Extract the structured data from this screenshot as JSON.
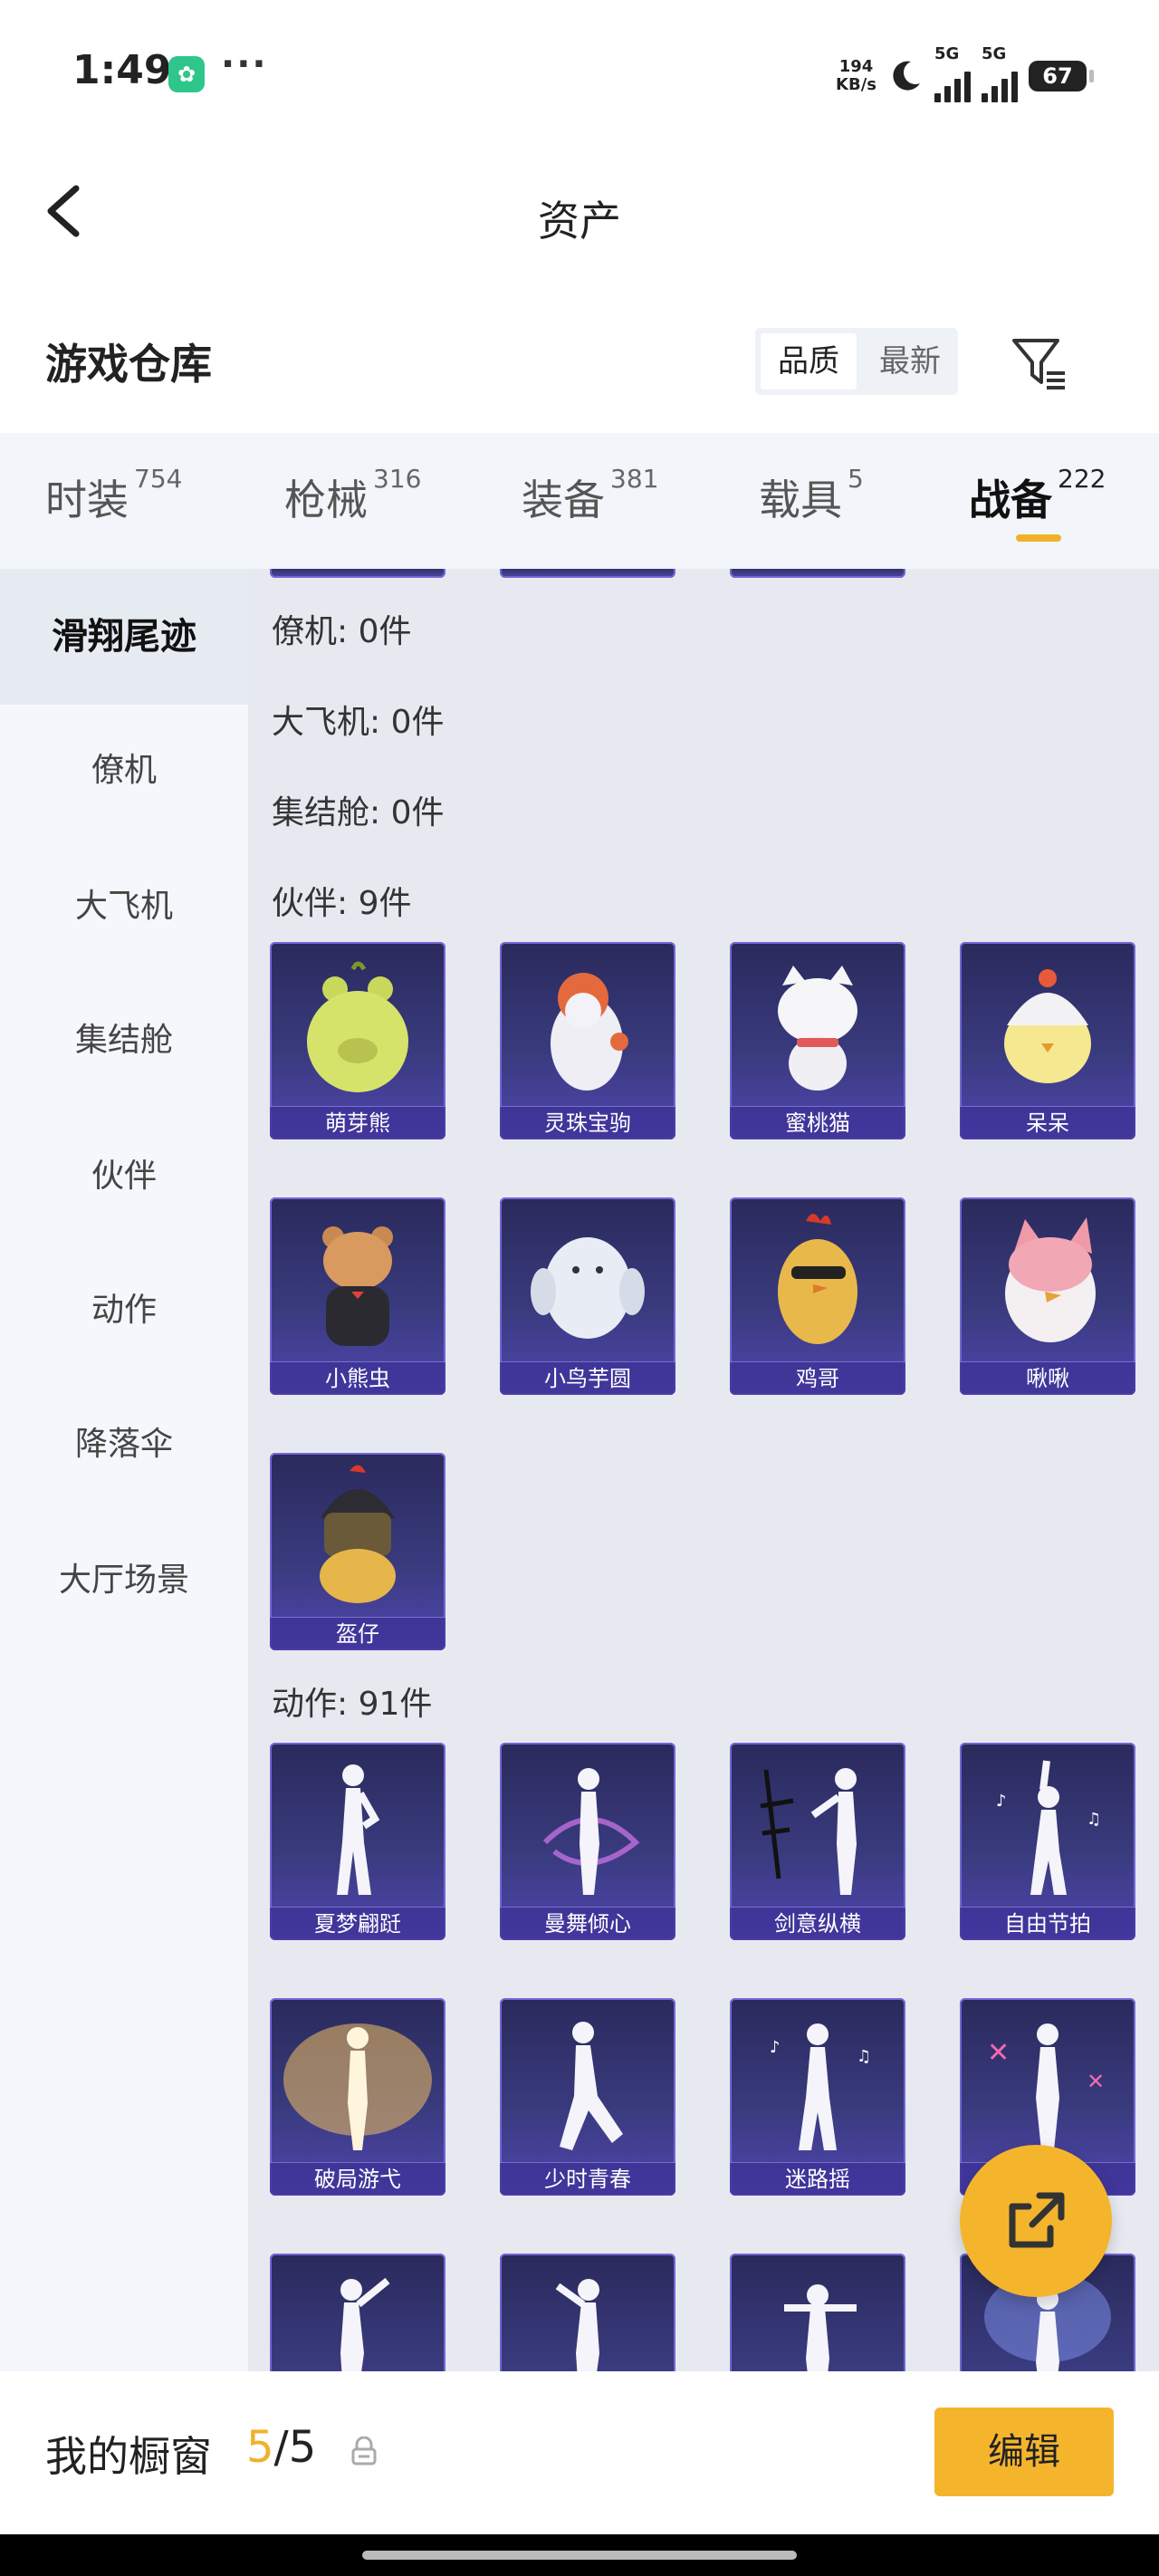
{
  "status": {
    "time": "1:49",
    "speed": "194",
    "speed_unit": "KB/s",
    "net1": "5G",
    "net2": "5G",
    "battery": "67"
  },
  "nav": {
    "title": "资产"
  },
  "header": {
    "title": "游戏仓库",
    "sort_quality": "品质",
    "sort_newest": "最新"
  },
  "tabs": [
    {
      "label": "时装",
      "count": "754"
    },
    {
      "label": "枪械",
      "count": "316"
    },
    {
      "label": "装备",
      "count": "381"
    },
    {
      "label": "载具",
      "count": "5"
    },
    {
      "label": "战备",
      "count": "222"
    }
  ],
  "sidebar": {
    "items": [
      {
        "label": "滑翔尾迹"
      },
      {
        "label": "僚机"
      },
      {
        "label": "大飞机"
      },
      {
        "label": "集结舱"
      },
      {
        "label": "伙伴"
      },
      {
        "label": "动作"
      },
      {
        "label": "降落伞"
      },
      {
        "label": "大厅场景"
      }
    ]
  },
  "sections": {
    "wingman": "僚机: 0件",
    "bigplane": "大飞机: 0件",
    "pod": "集结舱: 0件",
    "partner": "伙伴: 9件",
    "emote": "动作: 91件"
  },
  "partners": [
    "萌芽熊",
    "灵珠宝驹",
    "蜜桃猫",
    "呆呆",
    "小熊虫",
    "小鸟芋圆",
    "鸡哥",
    "啾啾",
    "盔仔"
  ],
  "emotes": [
    "夏梦翩跹",
    "曼舞倾心",
    "剑意纵横",
    "自由节拍",
    "破局游弋",
    "少时青春",
    "迷路摇",
    ""
  ],
  "bottom": {
    "label": "我的橱窗",
    "current": "5",
    "total": "/5",
    "edit": "编辑"
  },
  "colors": {
    "accent": "#f4b52d",
    "card_top": "#2a2a5c",
    "card_bottom": "#5046b0"
  }
}
